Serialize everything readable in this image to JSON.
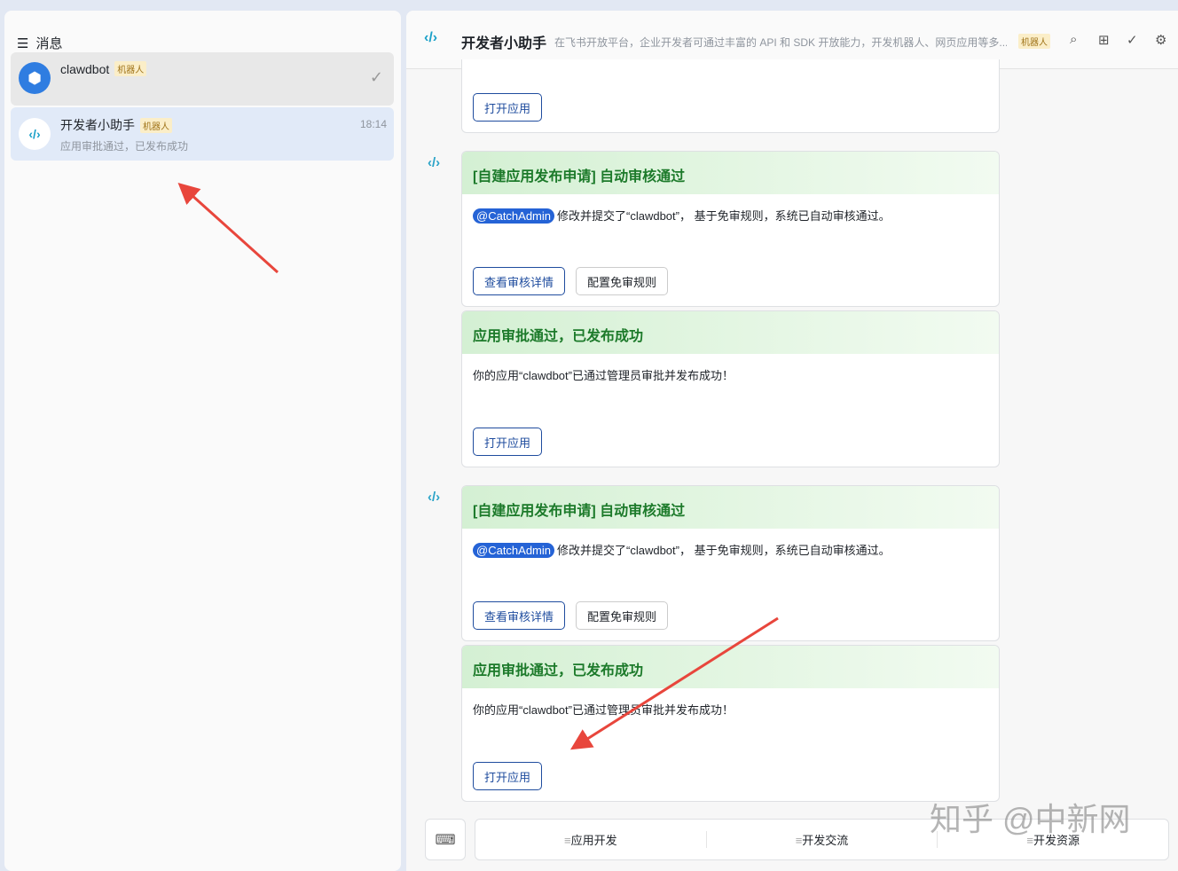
{
  "sidebar": {
    "title": "消息",
    "chats": [
      {
        "name": "clawdbot",
        "tag": "机器人",
        "preview": "",
        "time": ""
      },
      {
        "name": "开发者小助手",
        "tag": "机器人",
        "preview": "应用审批通过，已发布成功",
        "time": "18:14"
      }
    ]
  },
  "header": {
    "title": "开发者小助手",
    "description": "在飞书开放平台，企业开发者可通过丰富的 API 和 SDK 开放能力，开发机器人、网页应用等多...",
    "tag": "机器人"
  },
  "messages": [
    {
      "button": "打开应用"
    },
    {
      "title": "[自建应用发布申请] 自动审核通过",
      "mention": "@CatchAdmin",
      "text": "修改并提交了“clawdbot”， 基于免审规则，系统已自动审核通过。",
      "buttons": [
        "查看审核详情",
        "配置免审规则"
      ]
    },
    {
      "title": "应用审批通过，已发布成功",
      "text": "你的应用“clawdbot”已通过管理员审批并发布成功！",
      "buttons": [
        "打开应用"
      ]
    },
    {
      "title": "[自建应用发布申请] 自动审核通过",
      "mention": "@CatchAdmin",
      "text": "修改并提交了“clawdbot”， 基于免审规则，系统已自动审核通过。",
      "buttons": [
        "查看审核详情",
        "配置免审规则"
      ]
    },
    {
      "title": "应用审批通过，已发布成功",
      "text": "你的应用“clawdbot”已通过管理员审批并发布成功！",
      "buttons": [
        "打开应用"
      ]
    }
  ],
  "menu": [
    "应用开发",
    "开发交流",
    "开发资源"
  ],
  "watermark": "知乎 @中新网",
  "colors": {
    "accent": "#1f4c9e",
    "annotation_arrow": "#e8463c"
  }
}
